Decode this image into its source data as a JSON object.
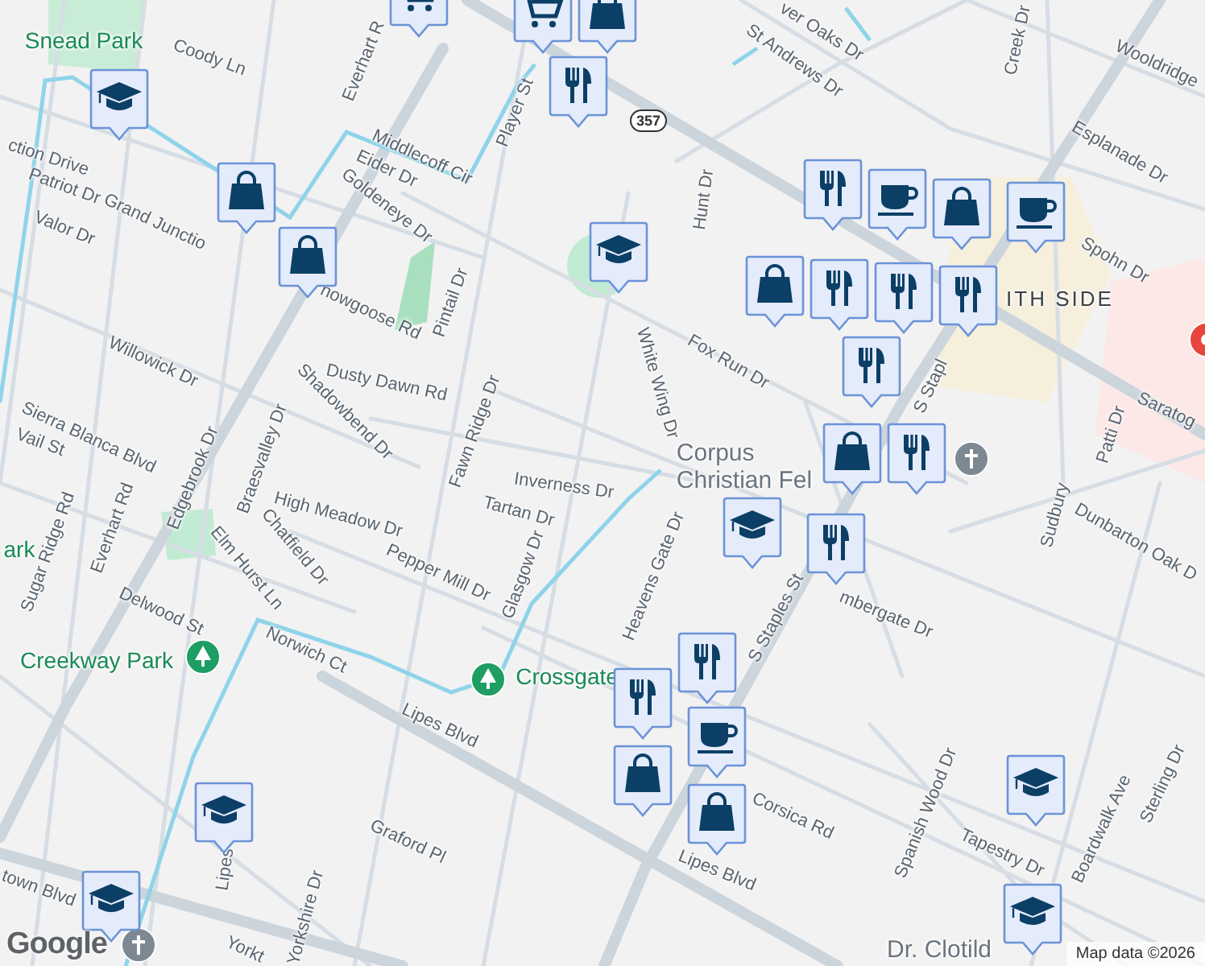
{
  "map": {
    "labels": [
      {
        "text": "Snead Park",
        "kind": "park"
      },
      {
        "text": "Coody Ln",
        "kind": "street"
      },
      {
        "text": "Everhart R",
        "kind": "street"
      },
      {
        "text": "Middlecoff Cir",
        "kind": "street"
      },
      {
        "text": "Eider Dr",
        "kind": "street"
      },
      {
        "text": "Player St",
        "kind": "street"
      },
      {
        "text": "Goldeneye Dr",
        "kind": "street"
      },
      {
        "text": "ction Drive",
        "kind": "street"
      },
      {
        "text": "Patriot Dr",
        "kind": "street"
      },
      {
        "text": "Valor Dr",
        "kind": "street"
      },
      {
        "text": "Grand Junctio",
        "kind": "street"
      },
      {
        "text": "nowgoose Rd",
        "kind": "street"
      },
      {
        "text": "Pintail Dr",
        "kind": "street"
      },
      {
        "text": "Willowick Dr",
        "kind": "street"
      },
      {
        "text": "Dusty Dawn Rd",
        "kind": "street"
      },
      {
        "text": "Shadowbend Dr",
        "kind": "street"
      },
      {
        "text": "Sierra Blanca Blvd",
        "kind": "street"
      },
      {
        "text": "Vail St",
        "kind": "street"
      },
      {
        "text": "Edgebrook Dr",
        "kind": "street"
      },
      {
        "text": "Braesvalley Dr",
        "kind": "street"
      },
      {
        "text": "Fawn Ridge Dr",
        "kind": "street"
      },
      {
        "text": "Inverness Dr",
        "kind": "street"
      },
      {
        "text": "High Meadow Dr",
        "kind": "street"
      },
      {
        "text": "Tartan Dr",
        "kind": "street"
      },
      {
        "text": "Sugar Ridge Rd",
        "kind": "street"
      },
      {
        "text": "Everhart Rd",
        "kind": "street"
      },
      {
        "text": "Elm Hurst Ln",
        "kind": "street"
      },
      {
        "text": "Chatfield Dr",
        "kind": "street"
      },
      {
        "text": "Pepper Mill Dr",
        "kind": "street"
      },
      {
        "text": "Glasgow Dr",
        "kind": "street"
      },
      {
        "text": "Delwood St",
        "kind": "street"
      },
      {
        "text": "Creekway Park",
        "kind": "park"
      },
      {
        "text": "ark",
        "kind": "park"
      },
      {
        "text": "Norwich Ct",
        "kind": "street"
      },
      {
        "text": "Crossgate",
        "kind": "park"
      },
      {
        "text": "Lipes Blvd",
        "kind": "street"
      },
      {
        "text": "Heavens Gate Dr",
        "kind": "street"
      },
      {
        "text": "S Staples St",
        "kind": "street"
      },
      {
        "text": "mbergate Dr",
        "kind": "street"
      },
      {
        "text": "Corsica Rd",
        "kind": "street"
      },
      {
        "text": "Lipes Blvd",
        "kind": "street"
      },
      {
        "text": "Graford Pl",
        "kind": "street"
      },
      {
        "text": "Yorkshire Dr",
        "kind": "street"
      },
      {
        "text": "Lipes",
        "kind": "street"
      },
      {
        "text": "town Blvd",
        "kind": "street"
      },
      {
        "text": "Yorkt",
        "kind": "street"
      },
      {
        "text": "Spanish Wood Dr",
        "kind": "street"
      },
      {
        "text": "Tapestry Dr",
        "kind": "street"
      },
      {
        "text": "Boardwalk Ave",
        "kind": "street"
      },
      {
        "text": "Sterling Dr",
        "kind": "street"
      },
      {
        "text": "Sudbury",
        "kind": "street"
      },
      {
        "text": "Dunbarton Oak D",
        "kind": "street"
      },
      {
        "text": "Dr. Clotild",
        "kind": "poi"
      },
      {
        "text": "Patti Dr",
        "kind": "street"
      },
      {
        "text": "Saratog",
        "kind": "street"
      },
      {
        "text": "Spohn Dr",
        "kind": "street"
      },
      {
        "text": "Esplanade Dr",
        "kind": "street"
      },
      {
        "text": "Wooldridge",
        "kind": "street"
      },
      {
        "text": "Creek Dr",
        "kind": "street"
      },
      {
        "text": "St Andrews Dr",
        "kind": "street"
      },
      {
        "text": "ver Oaks Dr",
        "kind": "street"
      },
      {
        "text": "Hunt Dr",
        "kind": "street"
      },
      {
        "text": "Fox Run Dr",
        "kind": "street"
      },
      {
        "text": "White Wing Dr",
        "kind": "street"
      },
      {
        "text": "ITH SIDE",
        "kind": "district"
      },
      {
        "text": "S Stapl",
        "kind": "street"
      },
      {
        "text": "Corpus Christian Fel",
        "kind": "poi"
      }
    ],
    "places": [
      {
        "kind": "park"
      },
      {
        "kind": "park"
      },
      {
        "kind": "church"
      },
      {
        "kind": "church"
      },
      {
        "kind": "hospital"
      }
    ],
    "shields": [
      {
        "text": "357"
      }
    ],
    "markers": [
      {
        "kind": "cart"
      },
      {
        "kind": "cart"
      },
      {
        "kind": "shop"
      },
      {
        "kind": "food"
      },
      {
        "kind": "school"
      },
      {
        "kind": "shop"
      },
      {
        "kind": "shop"
      },
      {
        "kind": "school"
      },
      {
        "kind": "food"
      },
      {
        "kind": "cafe"
      },
      {
        "kind": "shop"
      },
      {
        "kind": "cafe"
      },
      {
        "kind": "shop"
      },
      {
        "kind": "food"
      },
      {
        "kind": "food"
      },
      {
        "kind": "food"
      },
      {
        "kind": "food"
      },
      {
        "kind": "shop"
      },
      {
        "kind": "food"
      },
      {
        "kind": "school"
      },
      {
        "kind": "food"
      },
      {
        "kind": "food"
      },
      {
        "kind": "food"
      },
      {
        "kind": "cafe"
      },
      {
        "kind": "shop"
      },
      {
        "kind": "shop"
      },
      {
        "kind": "school"
      },
      {
        "kind": "school"
      },
      {
        "kind": "school"
      },
      {
        "kind": "school"
      }
    ]
  },
  "attribution": {
    "logo": "Google",
    "text": "Map data ©2026"
  }
}
